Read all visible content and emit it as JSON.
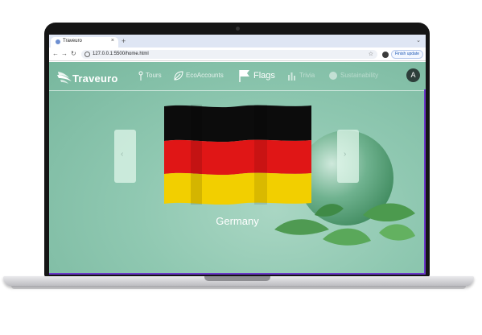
{
  "browser": {
    "tab_title": "Traveuro",
    "tab_close": "×",
    "new_tab": "+",
    "tab_menu": "⌄",
    "back": "←",
    "forward": "→",
    "reload": "↻",
    "url": "127.0.0.1:5500/home.html",
    "star": "☆",
    "finish_update": "Finish update"
  },
  "site": {
    "logo": "Traveuro",
    "nav": [
      {
        "label": "Tours",
        "icon": "pin-icon"
      },
      {
        "label": "EcoAccounts",
        "icon": "leaf-icon"
      },
      {
        "label": "Flags",
        "icon": "flag-icon"
      },
      {
        "label": "Trivia",
        "icon": "chart-icon"
      },
      {
        "label": "Sustainability",
        "icon": "globe-icon"
      }
    ],
    "avatar_initial": "A"
  },
  "carousel": {
    "country": "Germany",
    "prev": "‹",
    "next": "›",
    "flag_colors": [
      "#0c0c0c",
      "#e01616",
      "#f2cf00"
    ]
  }
}
